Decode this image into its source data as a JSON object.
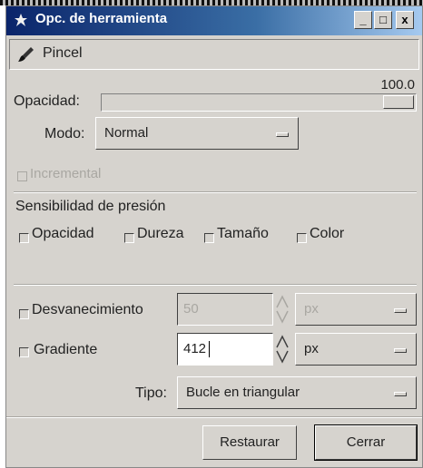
{
  "window": {
    "title": "Opc. de herramienta",
    "controls": {
      "minimize": "_",
      "maximize": "□",
      "close": "x"
    }
  },
  "tool": {
    "name": "Pincel",
    "icon": "paintbrush-icon"
  },
  "opacity": {
    "label": "Opacidad:",
    "value_text": "100.0",
    "value": 100.0
  },
  "mode": {
    "label": "Modo:",
    "value": "Normal"
  },
  "incremental": {
    "label": "Incremental",
    "checked": false,
    "enabled": false
  },
  "pressure": {
    "title": "Sensibilidad de presión",
    "options": [
      {
        "label": "Opacidad",
        "checked": false
      },
      {
        "label": "Dureza",
        "checked": false
      },
      {
        "label": "Tamaño",
        "checked": false
      },
      {
        "label": "Color",
        "checked": false
      }
    ]
  },
  "fade": {
    "label": "Desvanecimiento",
    "value": "50",
    "unit": "px",
    "enabled": false
  },
  "gradient": {
    "label": "Gradiente",
    "value": "412",
    "unit": "px",
    "enabled": true
  },
  "type": {
    "label": "Tipo:",
    "value": "Bucle en triangular"
  },
  "buttons": {
    "reset": "Restaurar",
    "close": "Cerrar"
  },
  "colors": {
    "title_bar_start": "#0a246a",
    "title_bar_end": "#a6caf0",
    "dialog_bg": "#d6d3ce"
  }
}
